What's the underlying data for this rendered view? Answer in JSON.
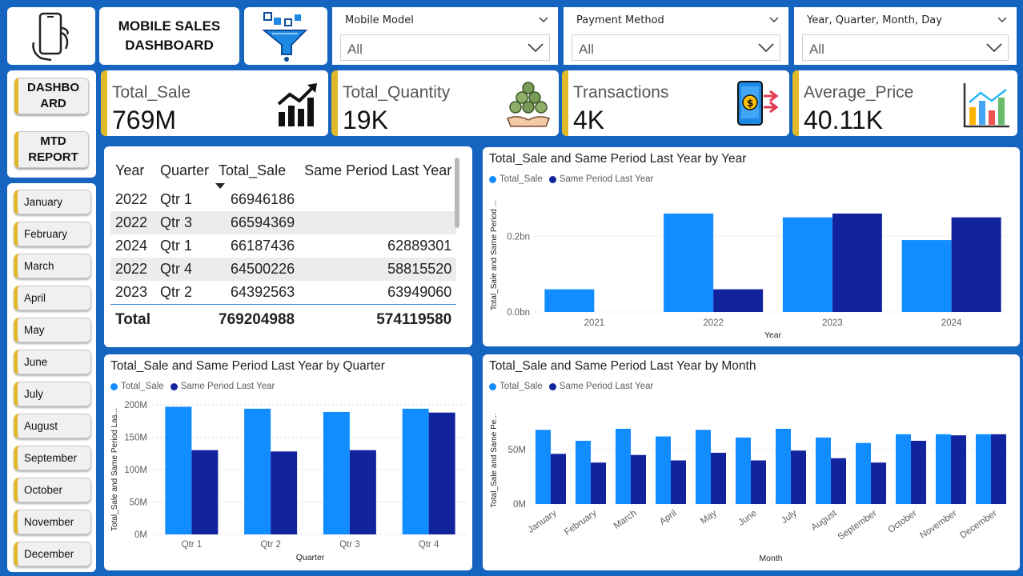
{
  "header": {
    "title_line1": "MOBILE SALES",
    "title_line2": "DASHBOARD"
  },
  "icons": {
    "logo": "phone-hand-icon",
    "filter": "funnel-icon"
  },
  "slicers": [
    {
      "label": "Mobile Model",
      "value": "All"
    },
    {
      "label": "Payment Method",
      "value": "All"
    },
    {
      "label": "Year, Quarter, Month, Day",
      "value": "All"
    }
  ],
  "nav": {
    "dashboard_line1": "DASHBO",
    "dashboard_line2": "ARD",
    "mtd_line1": "MTD",
    "mtd_line2": "REPORT"
  },
  "months": [
    "January",
    "February",
    "March",
    "April",
    "May",
    "June",
    "July",
    "August",
    "September",
    "October",
    "November",
    "December"
  ],
  "kpis": [
    {
      "label": "Total_Sale",
      "value": "769M",
      "icon": "growth-chart-icon"
    },
    {
      "label": "Total_Quantity",
      "value": "19K",
      "icon": "coins-hand-icon"
    },
    {
      "label": "Transactions",
      "value": "4K",
      "icon": "phone-payment-icon"
    },
    {
      "label": "Average_Price",
      "value": "40.11K",
      "icon": "bar-chart-icon"
    }
  ],
  "table": {
    "headers": [
      "Year",
      "Quarter",
      "Total_Sale",
      "Same Period Last Year"
    ],
    "rows": [
      [
        "2022",
        "Qtr 1",
        "66946186",
        ""
      ],
      [
        "2022",
        "Qtr 3",
        "66594369",
        ""
      ],
      [
        "2024",
        "Qtr 1",
        "66187436",
        "62889301"
      ],
      [
        "2022",
        "Qtr 4",
        "64500226",
        "58815520"
      ],
      [
        "2023",
        "Qtr 2",
        "64392563",
        "63949060"
      ]
    ],
    "total": [
      "Total",
      "",
      "769204988",
      "574119580"
    ]
  },
  "colors": {
    "total_sale": "#118dff",
    "same_period": "#12239e",
    "accent": "#e0b92a",
    "background": "#1565c0"
  },
  "chart_data": [
    {
      "type": "bar",
      "title": "Total_Sale and Same Period Last Year by Year",
      "xlabel": "Year",
      "ylabel": "Total_Sale and Same Period ...",
      "categories": [
        "2021",
        "2022",
        "2023",
        "2024"
      ],
      "series": [
        {
          "name": "Total_Sale",
          "values": [
            0.06,
            0.26,
            0.25,
            0.19
          ]
        },
        {
          "name": "Same Period Last Year",
          "values": [
            0,
            0.06,
            0.26,
            0.25
          ]
        }
      ],
      "ylim": [
        0,
        0.3
      ],
      "yticks": [
        "0.0bn",
        "0.2bn"
      ],
      "ytick_values": [
        0,
        0.2
      ],
      "legend": "top-left"
    },
    {
      "type": "bar",
      "title": "Total_Sale and Same Period Last Year by Quarter",
      "xlabel": "Quarter",
      "ylabel": "Total_Sale and Same Period Las...",
      "categories": [
        "Qtr 1",
        "Qtr 2",
        "Qtr 3",
        "Qtr 4"
      ],
      "series": [
        {
          "name": "Total_Sale",
          "values": [
            197,
            194,
            189,
            194
          ]
        },
        {
          "name": "Same Period Last Year",
          "values": [
            130,
            128,
            130,
            188
          ]
        }
      ],
      "ylim": [
        0,
        200
      ],
      "yticks": [
        "0M",
        "50M",
        "100M",
        "150M",
        "200M"
      ],
      "ytick_values": [
        0,
        50,
        100,
        150,
        200
      ],
      "legend": "top-left"
    },
    {
      "type": "bar",
      "title": "Total_Sale and Same Period Last Year by Month",
      "xlabel": "Month",
      "ylabel": "Total_Sale and Same Pe...",
      "categories": [
        "January",
        "February",
        "March",
        "April",
        "May",
        "June",
        "July",
        "August",
        "September",
        "October",
        "November",
        "December"
      ],
      "series": [
        {
          "name": "Total_Sale",
          "values": [
            68,
            58,
            69,
            62,
            68,
            61,
            69,
            61,
            56,
            64,
            64,
            64
          ]
        },
        {
          "name": "Same Period Last Year",
          "values": [
            46,
            38,
            45,
            40,
            47,
            40,
            49,
            42,
            38,
            58,
            63,
            64
          ]
        }
      ],
      "ylim": [
        0,
        80
      ],
      "yticks": [
        "0M",
        "50M"
      ],
      "ytick_values": [
        0,
        50
      ],
      "legend": "top-left"
    }
  ]
}
